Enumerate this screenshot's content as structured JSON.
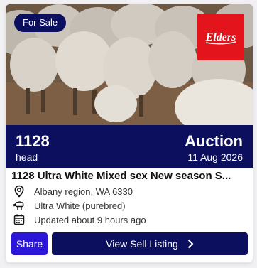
{
  "listing": {
    "status_badge": "For Sale",
    "brand_logo_text": "Elders",
    "head_count": "1128",
    "head_unit": "head",
    "sale_type": "Auction",
    "sale_date": "11 Aug 2026",
    "title": "1128 Ultra White Mixed sex New season S...",
    "location": "Albany region, WA 6330",
    "breed": "Ultra White (purebred)",
    "updated": "Updated about 9 hours ago"
  },
  "actions": {
    "share_label": "Share",
    "view_label": "View Sell Listing"
  },
  "icons": {
    "location": "location-pin-icon",
    "breed": "sheep-icon",
    "updated": "calendar-icon",
    "view": "chevron-right-icon"
  },
  "colors": {
    "navy": "#0c0f5e",
    "share_blue": "#2c17d8",
    "brand_red": "#e3141c"
  }
}
